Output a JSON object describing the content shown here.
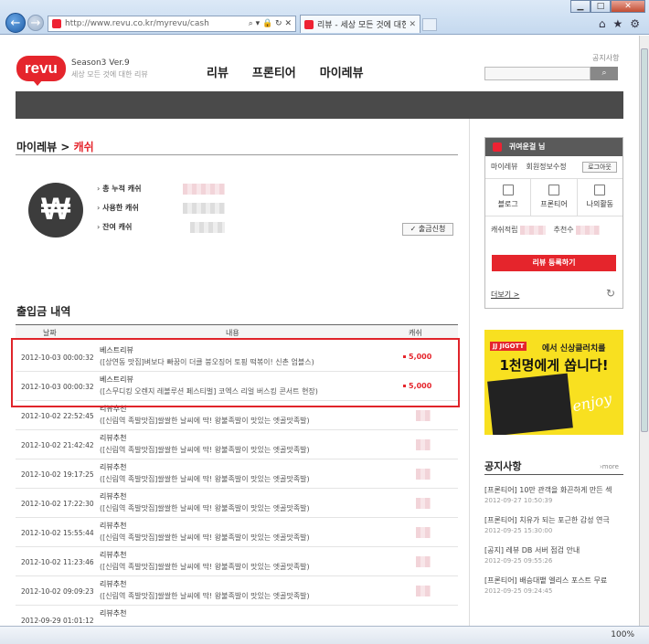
{
  "browser": {
    "url": "http://www.revu.co.kr/myrevu/cash",
    "tab_title": "리뷰 - 세상 모든 것에 대한...",
    "zoom": "100%",
    "addr_controls": "⌕ ▾ 🔒 ↻ ✕"
  },
  "header": {
    "logo": "revu",
    "season": "Season3 Ver.9",
    "tagline": "세상 모든 것에 대한 리뷰",
    "nav": [
      "리뷰",
      "프론티어",
      "마이레뷰"
    ],
    "notice_link": "공지사항"
  },
  "breadcrumb": {
    "root": "마이레뷰 >",
    "current": "캐쉬"
  },
  "cash_summary": {
    "total_label": "총 누적 캐쉬",
    "used_label": "사용한 캐쉬",
    "remaining_label": "잔여 캐쉬",
    "withdraw_btn": "✓ 출금신청"
  },
  "history": {
    "title": "출입금 내역",
    "columns": [
      "날짜",
      "내용",
      "캐쉬"
    ],
    "rows": [
      {
        "date": "2012-10-03 00:00:32",
        "cat": "베스트리뷰",
        "desc": "([상연동 맛집]벼보다 빠꿈이 더클 붕오징어 토핑 떡볶이! 신촌 엄블스)",
        "amt": "5,000"
      },
      {
        "date": "2012-10-03 00:00:32",
        "cat": "베스트리뷰",
        "desc": "([스무디킹 오렌지 레볼루션 페스티벌] 코엑스 리얼 버스킹 콘서트 현장)",
        "amt": "5,000"
      },
      {
        "date": "2012-10-02 22:52:45",
        "cat": "리뷰추천",
        "desc": "([신림역 족발맛집]쌀쌀한 날씨에 딱! 왕불족발이 맛있는 엣골맛족발)",
        "amt": ""
      },
      {
        "date": "2012-10-02 21:42:42",
        "cat": "리뷰추천",
        "desc": "([신림역 족발맛집]쌀쌀한 날씨에 딱! 왕불족발이 맛있는 엣골맛족발)",
        "amt": ""
      },
      {
        "date": "2012-10-02 19:17:25",
        "cat": "리뷰추천",
        "desc": "([신림역 족발맛집]쌀쌀한 날씨에 딱! 왕불족발이 맛있는 엣골맛족발)",
        "amt": ""
      },
      {
        "date": "2012-10-02 17:22:30",
        "cat": "리뷰추천",
        "desc": "([신림역 족발맛집]쌀쌀한 날씨에 딱! 왕불족발이 맛있는 엣골맛족발)",
        "amt": ""
      },
      {
        "date": "2012-10-02 15:55:44",
        "cat": "리뷰추천",
        "desc": "([신림역 족발맛집]쌀쌀한 날씨에 딱! 왕불족발이 맛있는 엣골맛족발)",
        "amt": ""
      },
      {
        "date": "2012-10-02 11:23:46",
        "cat": "리뷰추천",
        "desc": "([신림역 족발맛집]쌀쌀한 날씨에 딱! 왕불족발이 맛있는 엣골맛족발)",
        "amt": ""
      },
      {
        "date": "2012-10-02 09:09:23",
        "cat": "리뷰추천",
        "desc": "([신림역 족발맛집]쌀쌀한 날씨에 딱! 왕불족발이 맛있는 엣골맛족발)",
        "amt": ""
      },
      {
        "date": "2012-09-29 01:01:12",
        "cat": "리뷰추천",
        "desc": "",
        "amt": ""
      }
    ]
  },
  "user_box": {
    "name": "귀여운걸",
    "suffix": "님",
    "links": [
      "마이레뷰",
      "회원정보수정"
    ],
    "logout": "로그아웃",
    "tabs": [
      "블로그",
      "프론티어",
      "나의활동"
    ],
    "cash_label": "캐쉬적립",
    "recommend_label": "추천수",
    "register_btn": "리뷰 등록하기",
    "more": "더보기 >"
  },
  "banner": {
    "brand": "JJ JIGOTT",
    "line1": "에서 신상클러치를",
    "line2": "1천명에게 쏩니다!",
    "enjoy": "enjoy"
  },
  "notice": {
    "title": "공지사항",
    "more": "›more",
    "items": [
      {
        "title": "[프론티어] 10만 관객을 화끈하게 만든 섹",
        "date": "2012-09-27 10:50:39"
      },
      {
        "title": "[프론티어] 치유가 되는 포근한 감성 연극",
        "date": "2012-09-25 15:30:00"
      },
      {
        "title": "[공지] 레뷰 DB 서버 점검 안내",
        "date": "2012-09-25 09:55:26"
      },
      {
        "title": "[프론티어] 배승대뱉 엘리스 포스트 무료",
        "date": "2012-09-25 09:24:45"
      }
    ]
  }
}
